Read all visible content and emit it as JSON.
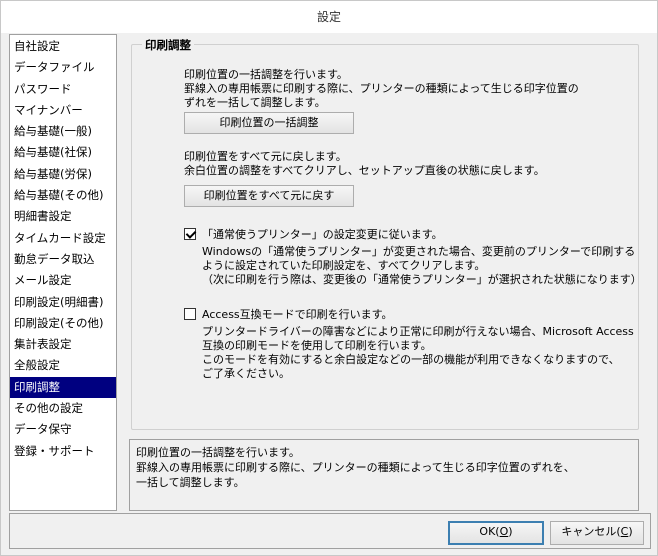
{
  "window": {
    "title": "設定"
  },
  "sidebar": {
    "items": [
      {
        "label": "自社設定",
        "selected": false
      },
      {
        "label": "データファイル",
        "selected": false
      },
      {
        "label": "パスワード",
        "selected": false
      },
      {
        "label": "マイナンバー",
        "selected": false
      },
      {
        "label": "給与基礎(一般)",
        "selected": false
      },
      {
        "label": "給与基礎(社保)",
        "selected": false
      },
      {
        "label": "給与基礎(労保)",
        "selected": false
      },
      {
        "label": "給与基礎(その他)",
        "selected": false
      },
      {
        "label": "明細書設定",
        "selected": false
      },
      {
        "label": "タイムカード設定",
        "selected": false
      },
      {
        "label": "勤怠データ取込",
        "selected": false
      },
      {
        "label": "メール設定",
        "selected": false
      },
      {
        "label": "印刷設定(明細書)",
        "selected": false
      },
      {
        "label": "印刷設定(その他)",
        "selected": false
      },
      {
        "label": "集計表設定",
        "selected": false
      },
      {
        "label": "全般設定",
        "selected": false
      },
      {
        "label": "印刷調整",
        "selected": true
      },
      {
        "label": "その他の設定",
        "selected": false
      },
      {
        "label": "データ保守",
        "selected": false
      },
      {
        "label": "登録・サポート",
        "selected": false
      }
    ]
  },
  "main": {
    "group_title": "印刷調整",
    "bulk_adjust": {
      "desc_lines": [
        "印刷位置の一括調整を行います。",
        "罫線入の専用帳票に印刷する際に、プリンターの種類によって生じる印字位置の",
        "ずれを一括して調整します。"
      ],
      "button_label": "印刷位置の一括調整"
    },
    "reset": {
      "desc_lines": [
        "印刷位置をすべて元に戻します。",
        "余白位置の調整をすべてクリアし、セットアップ直後の状態に戻します。"
      ],
      "button_label": "印刷位置をすべて元に戻す"
    },
    "default_printer": {
      "checked": true,
      "label": "「通常使うプリンター」の設定変更に従います。",
      "desc_lines": [
        "Windowsの「通常使うプリンター」が変更された場合、変更前のプリンターで印刷する",
        "ように設定されていた印刷設定を、すべてクリアします。",
        "（次に印刷を行う際は、変更後の「通常使うプリンター」が選択された状態になります）"
      ]
    },
    "access_mode": {
      "checked": false,
      "label": "Access互換モードで印刷を行います。",
      "desc_lines": [
        "プリンタードライバーの障害などにより正常に印刷が行えない場合、Microsoft Access",
        "互換の印刷モードを使用して印刷を行います。",
        "このモードを有効にすると余白設定などの一部の機能が利用できなくなりますので、",
        "ご了承ください。"
      ]
    }
  },
  "status": {
    "lines": [
      "印刷位置の一括調整を行います。",
      "罫線入の専用帳票に印刷する際に、プリンターの種類によって生じる印字位置のずれを、",
      "一括して調整します。"
    ]
  },
  "footer": {
    "ok_label": "OK(",
    "ok_key": "O",
    "ok_suffix": ")",
    "cancel_label": "キャンセル(",
    "cancel_key": "C",
    "cancel_suffix": ")"
  }
}
